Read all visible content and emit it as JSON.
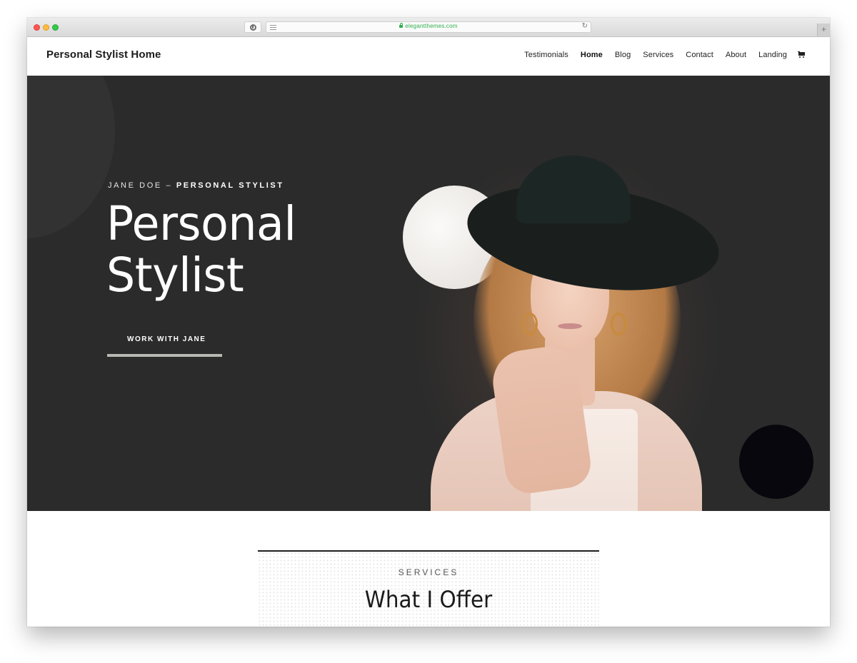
{
  "browser": {
    "url": "elegantthemes.com",
    "secure": true,
    "icons": {
      "extension": "password-manager-icon",
      "reader": "reader-view-icon",
      "reload": "reload-icon",
      "new_tab": "plus-icon",
      "lock": "lock-icon"
    },
    "reload_glyph": "↻",
    "new_tab_glyph": "+"
  },
  "header": {
    "site_title": "Personal Stylist Home",
    "nav": [
      {
        "label": "Testimonials",
        "active": false
      },
      {
        "label": "Home",
        "active": true
      },
      {
        "label": "Blog",
        "active": false
      },
      {
        "label": "Services",
        "active": false
      },
      {
        "label": "Contact",
        "active": false
      },
      {
        "label": "About",
        "active": false
      },
      {
        "label": "Landing",
        "active": false
      }
    ],
    "cart_icon": "shopping-cart-icon"
  },
  "hero": {
    "eyebrow_name": "JANE DOE",
    "eyebrow_separator": " – ",
    "eyebrow_role": "PERSONAL STYLIST",
    "title_line1": "Personal",
    "title_line2": "Stylist",
    "cta_label": "WORK WITH JANE",
    "image_alt": "Portrait of a woman with curly blonde hair wearing a black wide-brim hat",
    "colors": {
      "background": "#2b2b2b",
      "accent_light": "#f4f1ee",
      "accent_dark": "#07070d",
      "cta_underline": "#b8b8b2"
    }
  },
  "services": {
    "eyebrow": "SERVICES",
    "title": "What I Offer"
  }
}
